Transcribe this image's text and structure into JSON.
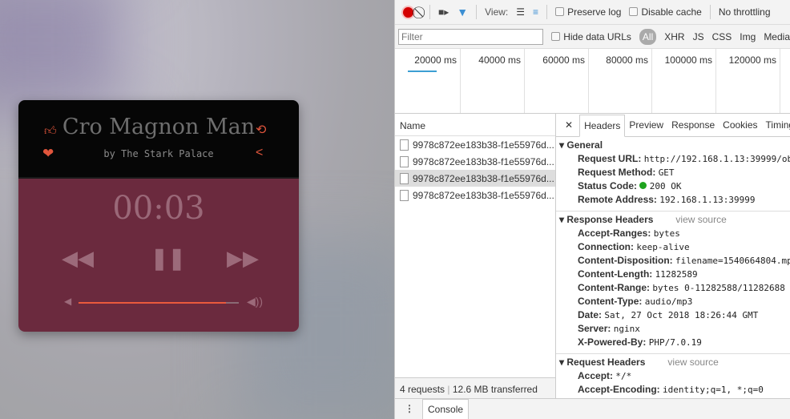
{
  "player": {
    "title": "Cro Magnon Man",
    "artist": "by The Stark Palace",
    "time": "00:03",
    "volume": 0.92,
    "accent": "#e0553c",
    "panel_color": "#6b2a3e"
  },
  "devtools": {
    "toolbar": {
      "view_label": "View:",
      "preserve_log": "Preserve log",
      "disable_cache": "Disable cache",
      "throttle": "No throttling"
    },
    "filter": {
      "placeholder": "Filter",
      "hide_data_urls": "Hide data URLs",
      "types": [
        "All",
        "XHR",
        "JS",
        "CSS",
        "Img",
        "Media"
      ]
    },
    "timeline": {
      "ticks": [
        "20000 ms",
        "40000 ms",
        "60000 ms",
        "80000 ms",
        "100000 ms",
        "120000 ms"
      ]
    },
    "list": {
      "header": "Name",
      "rows": [
        "9978c872ee183b38-f1e55976d...",
        "9978c872ee183b38-f1e55976d...",
        "9978c872ee183b38-f1e55976d...",
        "9978c872ee183b38-f1e55976d..."
      ],
      "selected": 2,
      "requests": "4 requests",
      "transferred": "12.6 MB transferred"
    },
    "tabs": [
      "Headers",
      "Preview",
      "Response",
      "Cookies",
      "Timing"
    ],
    "general": {
      "title": "General",
      "items": [
        {
          "k": "Request URL:",
          "v": "http://192.168.1.13:39999/ob"
        },
        {
          "k": "Request Method:",
          "v": "GET"
        },
        {
          "k": "Status Code:",
          "v": "200 OK"
        },
        {
          "k": "Remote Address:",
          "v": "192.168.1.13:39999"
        }
      ]
    },
    "response_headers": {
      "title": "Response Headers",
      "view_source": "view source",
      "items": [
        {
          "k": "Accept-Ranges:",
          "v": "bytes"
        },
        {
          "k": "Connection:",
          "v": "keep-alive"
        },
        {
          "k": "Content-Disposition:",
          "v": "filename=1540664804.mp"
        },
        {
          "k": "Content-Length:",
          "v": "11282589"
        },
        {
          "k": "Content-Range:",
          "v": "bytes 0-11282588/11282688"
        },
        {
          "k": "Content-Type:",
          "v": "audio/mp3"
        },
        {
          "k": "Date:",
          "v": "Sat, 27 Oct 2018 18:26:44 GMT"
        },
        {
          "k": "Server:",
          "v": "nginx"
        },
        {
          "k": "X-Powered-By:",
          "v": "PHP/7.0.19"
        }
      ]
    },
    "request_headers": {
      "title": "Request Headers",
      "view_source": "view source",
      "items": [
        {
          "k": "Accept:",
          "v": "*/*"
        },
        {
          "k": "Accept-Encoding:",
          "v": "identity;q=1, *;q=0"
        }
      ]
    },
    "console_tab": "Console"
  }
}
